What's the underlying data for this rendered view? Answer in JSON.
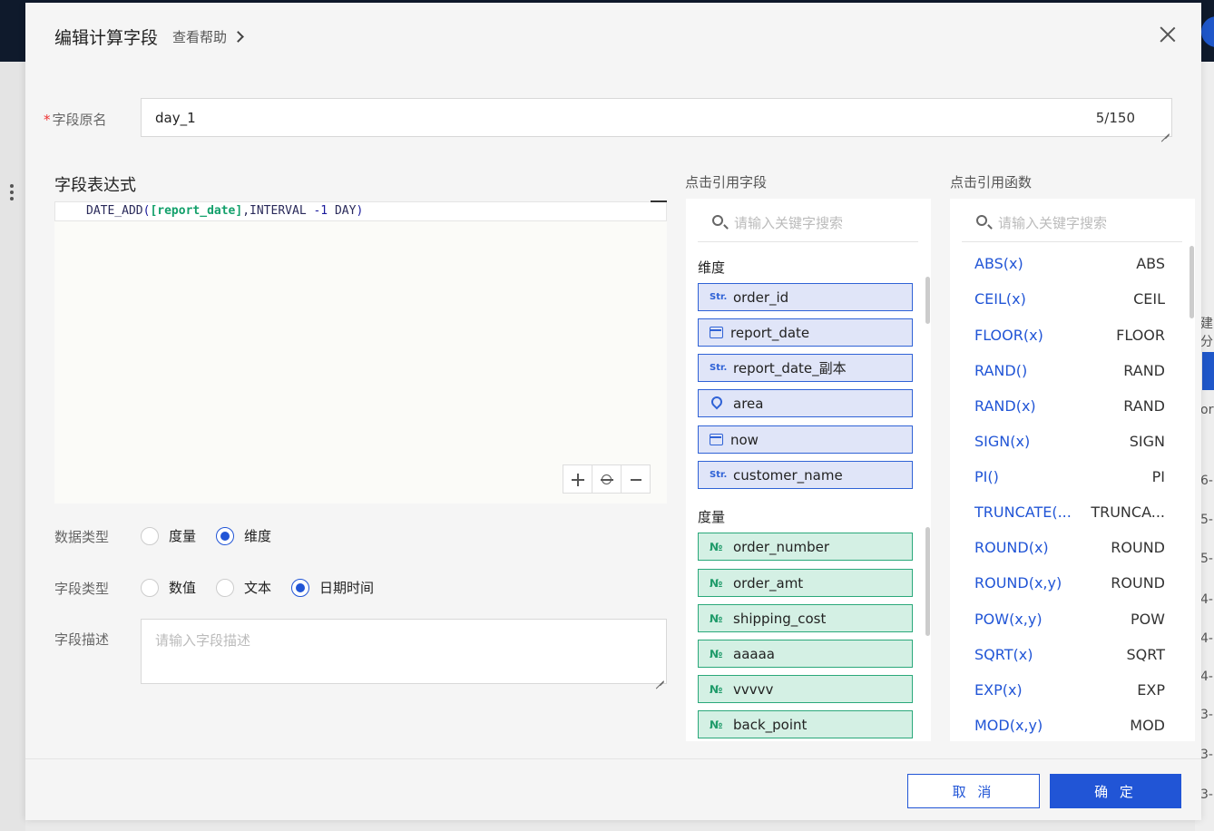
{
  "dialog": {
    "title": "编辑计算字段",
    "help_label": "查看帮助"
  },
  "name_field": {
    "label": "字段原名",
    "value": "day_1",
    "counter": "5/150"
  },
  "expression": {
    "title": "字段表达式",
    "code": {
      "fn": "DATE_ADD",
      "open": "(",
      "field": "[report_date]",
      "rest": ",INTERVAL ",
      "num": "-1",
      "unit": " DAY",
      "close": ")"
    }
  },
  "data_type": {
    "label": "数据类型",
    "options": [
      "度量",
      "维度"
    ],
    "selected": "维度"
  },
  "field_type": {
    "label": "字段类型",
    "options": [
      "数值",
      "文本",
      "日期时间"
    ],
    "selected": "日期时间"
  },
  "description": {
    "label": "字段描述",
    "placeholder": "请输入字段描述"
  },
  "fields_panel": {
    "title": "点击引用字段",
    "search_placeholder": "请输入关键字搜索",
    "dimension_title": "维度",
    "dimensions": [
      {
        "icon": "Str.",
        "name": "order_id"
      },
      {
        "icon": "calendar",
        "name": "report_date"
      },
      {
        "icon": "Str.",
        "name": "report_date_副本"
      },
      {
        "icon": "location",
        "name": "area"
      },
      {
        "icon": "calendar",
        "name": "now"
      },
      {
        "icon": "Str.",
        "name": "customer_name"
      }
    ],
    "measure_title": "度量",
    "measure_icon": "№",
    "measures": [
      "order_number",
      "order_amt",
      "shipping_cost",
      "aaaaa",
      "vvvvv",
      "back_point"
    ]
  },
  "functions_panel": {
    "title": "点击引用函数",
    "search_placeholder": "请输入关键字搜索",
    "functions": [
      {
        "fn": "ABS(x)",
        "name": "ABS"
      },
      {
        "fn": "CEIL(x)",
        "name": "CEIL"
      },
      {
        "fn": "FLOOR(x)",
        "name": "FLOOR"
      },
      {
        "fn": "RAND()",
        "name": "RAND"
      },
      {
        "fn": "RAND(x)",
        "name": "RAND"
      },
      {
        "fn": "SIGN(x)",
        "name": "SIGN"
      },
      {
        "fn": "PI()",
        "name": "PI"
      },
      {
        "fn": "TRUNCATE(...",
        "name": "TRUNCA..."
      },
      {
        "fn": "ROUND(x)",
        "name": "ROUND"
      },
      {
        "fn": "ROUND(x,y)",
        "name": "ROUND"
      },
      {
        "fn": "POW(x,y)",
        "name": "POW"
      },
      {
        "fn": "SQRT(x)",
        "name": "SQRT"
      },
      {
        "fn": "EXP(x)",
        "name": "EXP"
      },
      {
        "fn": "MOD(x,y)",
        "name": "MOD"
      }
    ]
  },
  "footer": {
    "cancel": "取 消",
    "ok": "确 定"
  },
  "background": {
    "right_edge_text": [
      "建分",
      "ort",
      "6-",
      "5-",
      "5-",
      "4-",
      "4-",
      "4-",
      "3-",
      "3-",
      "3-"
    ]
  },
  "colors": {
    "primary": "#2155d6",
    "dimension_bg": "#e0e5f8",
    "measure_bg": "#d4f0e4",
    "required": "#e33333"
  }
}
